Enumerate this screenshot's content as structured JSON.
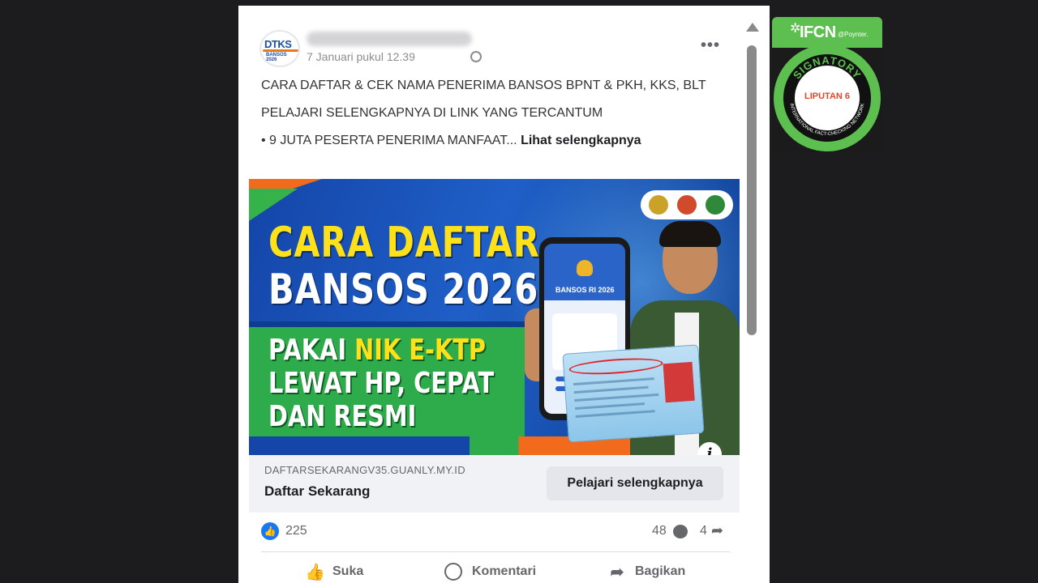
{
  "post": {
    "time": "7 Januari pukul 12.39",
    "avatar_text_top": "DTKS",
    "avatar_text_bottom": "BANSOS 2026",
    "text_line_1": "CARA  DAFTAR & CEK NAMA PENERIMA BANSOS BPNT & PKH, KKS, BLT",
    "text_line_2": "PELAJARI SELENGKAPNYA DI LINK YANG TERCANTUM",
    "text_line_3": "• 9 JUTA PESERTA PENERIMA MANFAAT...",
    "see_more": "Lihat selengkapnya"
  },
  "ad": {
    "headline_1": "CARA DAFTAR",
    "headline_2": "BANSOS 2026",
    "sub_1_a": "PAKAI ",
    "sub_1_b": "NIK E-KTP",
    "sub_2": "LEWAT HP, CEPAT",
    "sub_3": "DAN RESMI",
    "phone_title": "BANSOS RI 2026",
    "info_label": "i"
  },
  "link": {
    "domain": "DAFTARSEKARANGV35.GUANLY.MY.ID",
    "title": "Daftar Sekarang",
    "button": "Pelajari selengkapnya"
  },
  "stats": {
    "likes": "225",
    "comments": "48",
    "shares": "4"
  },
  "actions": {
    "like": "Suka",
    "comment": "Komentari",
    "share": "Bagikan"
  },
  "badge": {
    "ifcn": "IFCN",
    "poynter": "@Poynter.",
    "signatory": "SIGNATORY",
    "partner": "LIPUTAN 6",
    "network": "INTERNATIONAL FACT-CHECKING NETWORK"
  },
  "colors": {
    "facebook_blue": "#1877f2",
    "ifcn_green": "#5cbf4f",
    "ad_yellow": "#ffe11a",
    "ad_orange": "#f26a1b"
  }
}
